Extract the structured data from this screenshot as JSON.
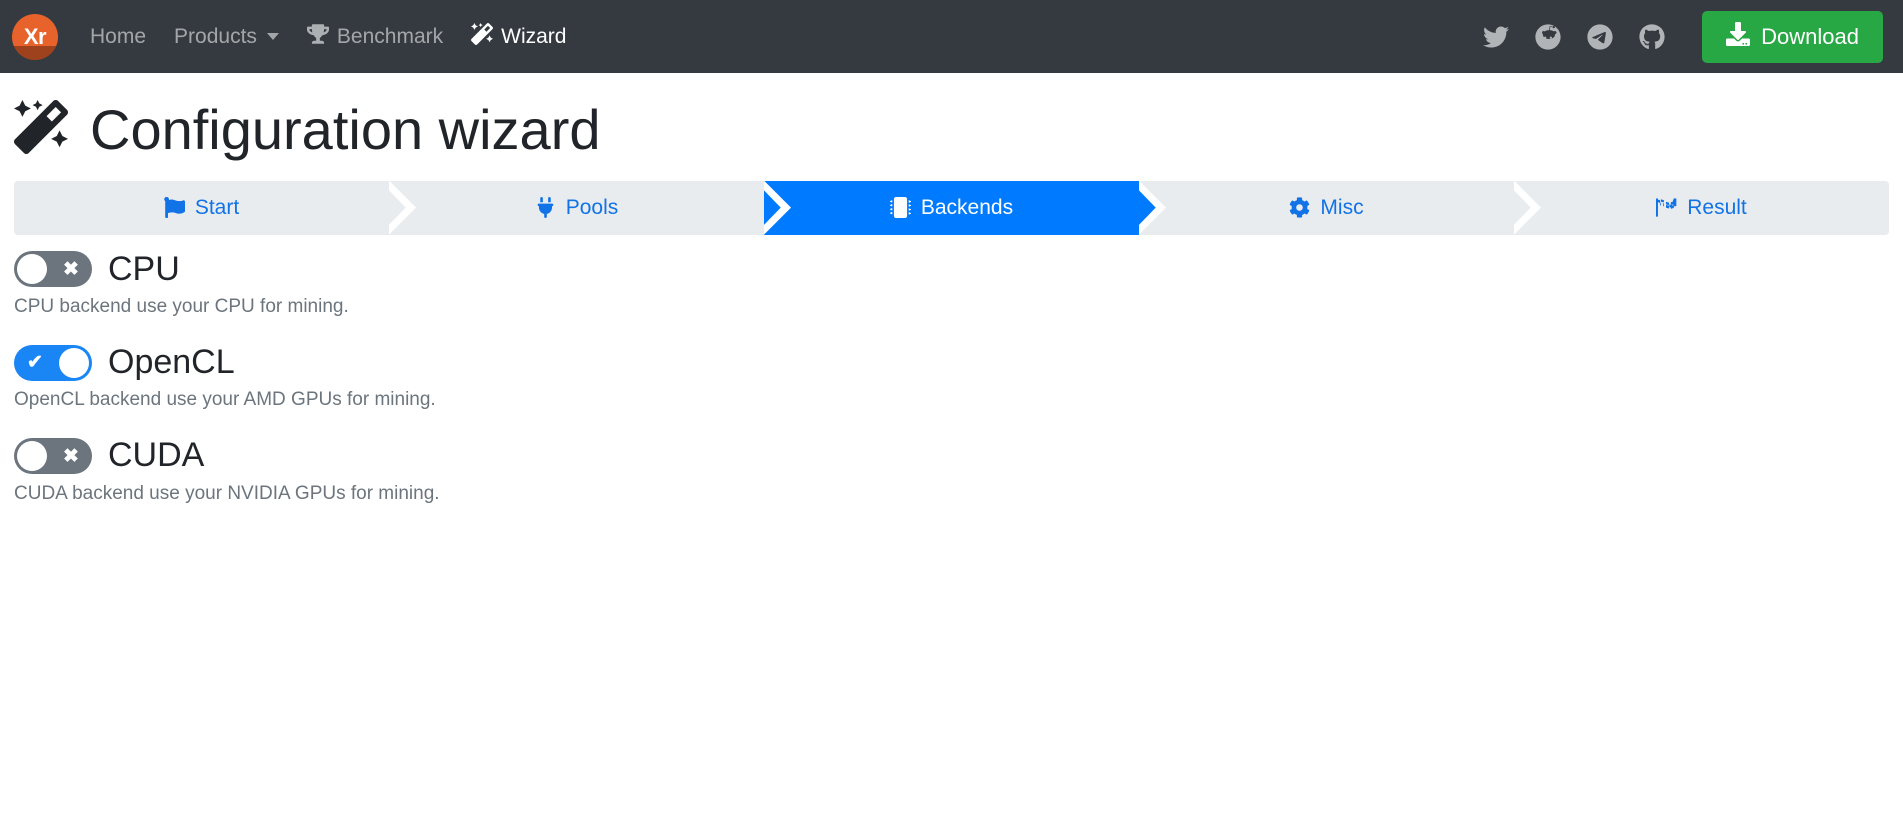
{
  "navbar": {
    "brand": {
      "text": "Xr",
      "icon": "xmrig-logo-icon",
      "color": "#e8622b"
    },
    "links": [
      {
        "label": "Home",
        "name": "nav-link-home",
        "active": false,
        "icon": null
      },
      {
        "label": "Products",
        "name": "nav-link-products",
        "active": false,
        "icon": "chevron-down-icon"
      },
      {
        "label": "Benchmark",
        "name": "nav-link-benchmark",
        "active": false,
        "icon": "trophy-icon"
      },
      {
        "label": "Wizard",
        "name": "nav-link-wizard",
        "active": true,
        "icon": "magic-wand-icon"
      }
    ],
    "social": [
      {
        "name": "twitter-icon",
        "label": "Twitter"
      },
      {
        "name": "reddit-icon",
        "label": "Reddit"
      },
      {
        "name": "telegram-icon",
        "label": "Telegram"
      },
      {
        "name": "github-icon",
        "label": "GitHub"
      }
    ],
    "download": {
      "label": "Download",
      "icon": "download-icon",
      "color": "#28a745"
    },
    "background": "#343a40"
  },
  "page": {
    "title": "Configuration wizard",
    "title_icon": "magic-wand-icon"
  },
  "steps": {
    "active_index": 2,
    "active_color": "#007bff",
    "inactive_bg": "#e9ecef",
    "inactive_color": "#1273e6",
    "items": [
      {
        "label": "Start",
        "icon": "flag-icon"
      },
      {
        "label": "Pools",
        "icon": "plug-icon"
      },
      {
        "label": "Backends",
        "icon": "microchip-icon"
      },
      {
        "label": "Misc",
        "icon": "gear-icon"
      },
      {
        "label": "Result",
        "icon": "checkered-flag-icon"
      }
    ]
  },
  "backends": [
    {
      "name": "CPU",
      "enabled": false,
      "mark": "✖",
      "description": "CPU backend use your CPU for mining."
    },
    {
      "name": "OpenCL",
      "enabled": true,
      "mark": "✔",
      "description": "OpenCL backend use your AMD GPUs for mining."
    },
    {
      "name": "CUDA",
      "enabled": false,
      "mark": "✖",
      "description": "CUDA backend use your NVIDIA GPUs for mining."
    }
  ]
}
